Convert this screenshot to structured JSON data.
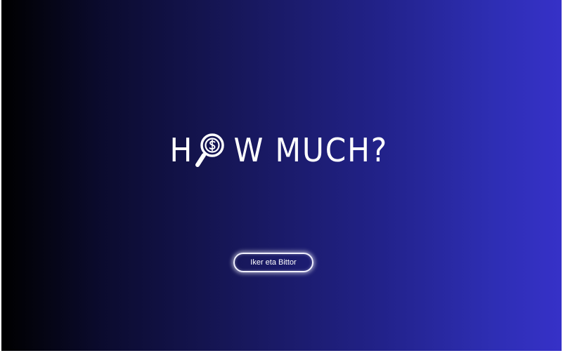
{
  "logo": {
    "letter_1": "H",
    "rest": "W MUCH?",
    "icon": "magnifier-dollar-icon"
  },
  "cta": {
    "label": "Iker eta Bittor"
  },
  "colors": {
    "gradient_start": "#000000",
    "gradient_end": "#3631c8",
    "text": "#ffffff"
  }
}
